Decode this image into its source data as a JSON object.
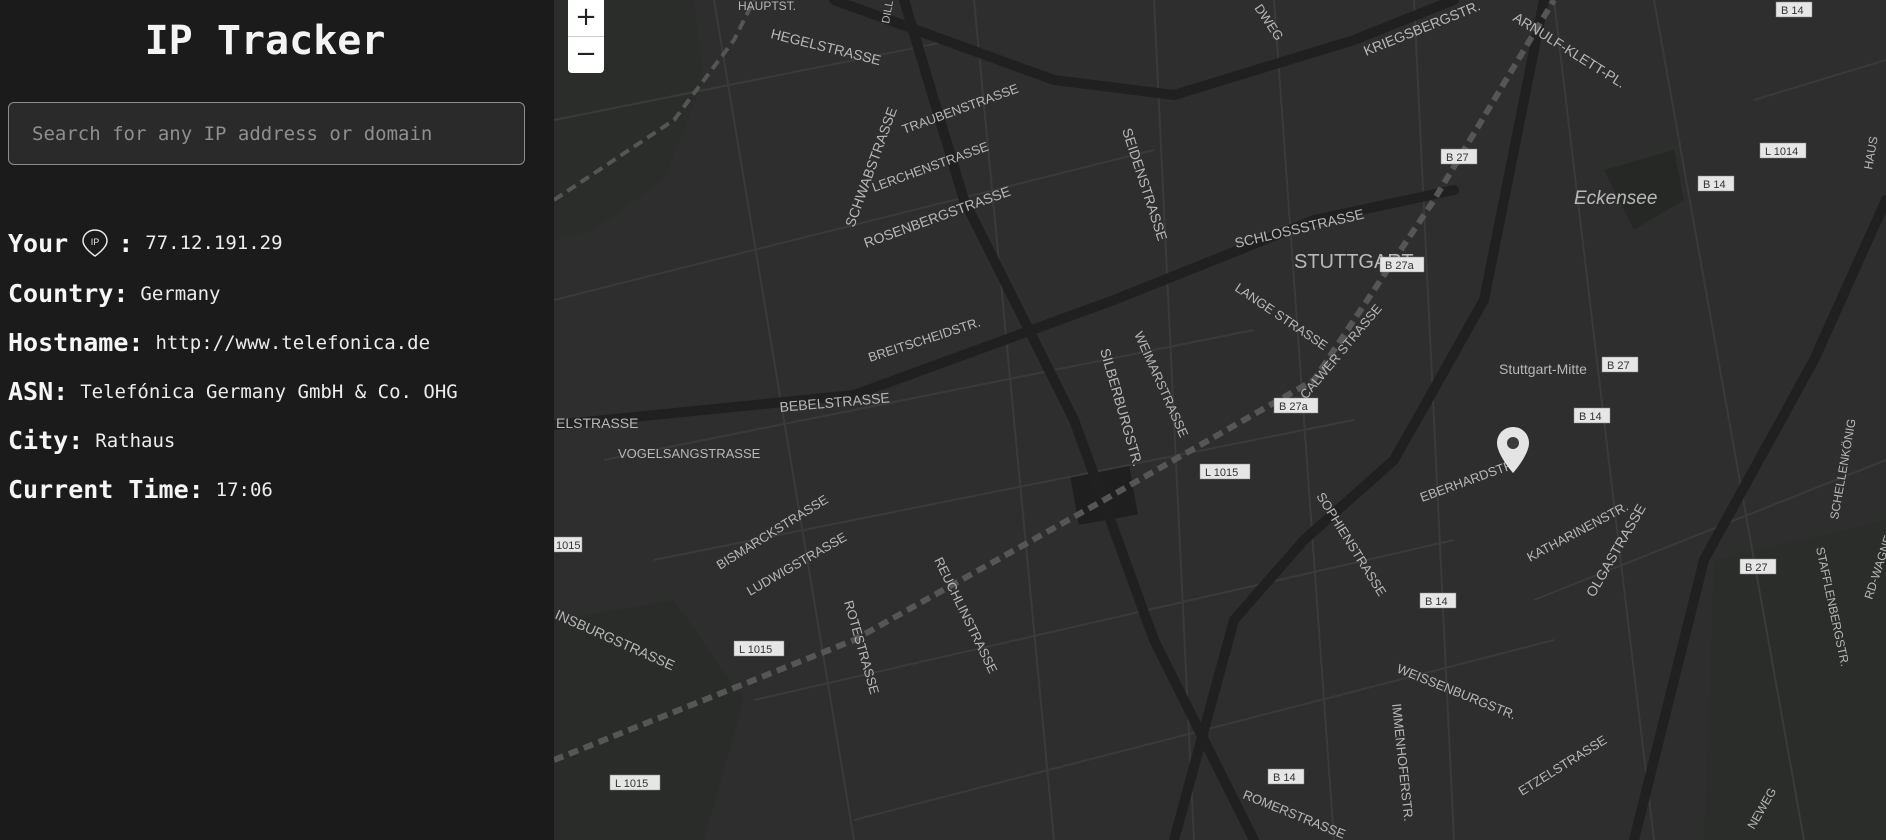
{
  "app": {
    "title": "IP Tracker"
  },
  "search": {
    "placeholder": "Search for any IP address or domain",
    "value": ""
  },
  "info": {
    "ip": {
      "label_prefix": "Your",
      "badge": "IP",
      "label_suffix": ":",
      "value": "77.12.191.29"
    },
    "country": {
      "label": "Country:",
      "value": "Germany"
    },
    "hostname": {
      "label": "Hostname:",
      "value": "http://www.telefonica.de"
    },
    "asn": {
      "label": "ASN:",
      "value": "Telefónica Germany GmbH & Co. OHG"
    },
    "city": {
      "label": "City:",
      "value": "Rathaus"
    },
    "time": {
      "label": "Current Time:",
      "value": "17:06"
    }
  },
  "map": {
    "zoom_in": "+",
    "zoom_out": "−",
    "labels": {
      "stuttgart": "STUTTGART",
      "eckensee": "Eckensee",
      "stuttgart_mitte": "Stuttgart-Mitte",
      "hegelstrasse": "HEGELSTRASSE",
      "kriegsbergstrasse": "KRIEGSBERGSTR.",
      "arnulf_klett": "ARNULF-KLETT-PL.",
      "schwabstrasse": "SCHWABSTRASSE",
      "rosenbergstrasse": "ROSENBERGSTRASSE",
      "lerchenstrasse": "LERCHENSTRASSE",
      "traubenstrasse": "TRAUBENSTRASSE",
      "seidenstrasse": "SEIDENSTRASSE",
      "schlossstrasse": "SCHLOSSSTRASSE",
      "breitscheidstr": "BREITSCHEIDSTR.",
      "bebelstrasse": "BEBELSTRASSE",
      "vogelsangstrasse": "VOGELSANGSTRASSE",
      "silberburgstr": "SILBERBURGSTR.",
      "weimarstrasse": "WEIMARSTRASSE",
      "lange_strasse": "LANGE STRASSE",
      "calwer_strasse": "CALWER STRASSE",
      "sophienstrasse": "SOPHIENSTRASSE",
      "eberhardstr": "EBERHARDSTR.",
      "katharinenstr": "KATHARINENSTR.",
      "olgastrasse": "OLGASTRASSE",
      "bismarckstrasse": "BISMARCKSTRASSE",
      "ludwigstrasse": "LUDWIGSTRASSE",
      "reuchlinstrasse": "REUCHLINSTRASSE",
      "rotestrasse": "ROTESTRASSE",
      "weissenburgstr": "WEISSENBURGSTR.",
      "immenhoferstr": "IMMENHOFERSTR.",
      "etzelstrasse": "ETZELSTRASSE",
      "romerstrasse": "ROMERSTRASSE",
      "elstrasse": "ELSTRASSE",
      "insburgstrasse": "INSBURGSTRASSE",
      "hauptstatter": "HAUPTST.",
      "dill": "DILL",
      "weg": "DWEG",
      "schellenkonig": "SCHELLENKÖNIG",
      "stafflenbergstr": "STAFFLENBERGSTR.",
      "richard_wagner": "RD-WAGNE",
      "haus": "HAUS",
      "neweg": "NEWEG"
    },
    "shields": {
      "b14_a": "B 14",
      "b14_b": "B 14",
      "b14_c": "B 14",
      "b14_d": "B 14",
      "b14_e": "B 14",
      "b27_a": "B 27",
      "b27_b": "B 27",
      "b27_c": "B 27",
      "b27a_a": "B 27a",
      "b27a_b": "B 27a",
      "l1014": "L 1014",
      "l1015_a": "L 1015",
      "l1015_b": "L 1015",
      "l1015_c": "L 1015",
      "l1015_d": "1015"
    }
  }
}
